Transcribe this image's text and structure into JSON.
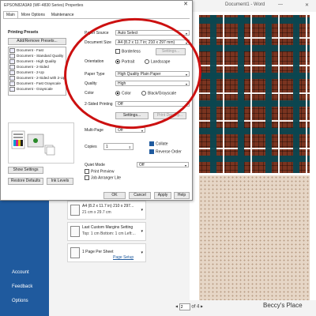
{
  "backstage": {
    "doc_title": "Document1 - Word",
    "menu": [
      "Account",
      "Feedback",
      "Options"
    ],
    "settings": [
      {
        "line1": "A4 (8.2 x 11.7 in) 210 x 297...",
        "line2": "21 cm x 29.7 cm"
      },
      {
        "line1": "Last Custom Margins Setting",
        "line2": "Top: 1 cm Bottom: 1 cm Left:..."
      },
      {
        "line1": "1 Page Per Sheet",
        "line2": ""
      }
    ],
    "page_setup_link": "Page Setup",
    "pager": {
      "current": "2",
      "of_label": "of 4"
    },
    "watermark": "Beccy's Place"
  },
  "dialog": {
    "title": "EPSON82A3A9 (WF-4830 Series) Properties",
    "close_glyph": "✕",
    "tabs": [
      "Main",
      "More Options",
      "Maintenance"
    ],
    "printing_presets_label": "Printing Presets",
    "add_remove_presets": "Add/Remove Presets...",
    "presets": [
      "Document - Fast",
      "Document - Standard Quality",
      "Document - High Quality",
      "Document - 2-Sided",
      "Document - 2-Up",
      "Document - 2-Sided with 2-Up",
      "Document - Fast Grayscale",
      "Document - Grayscale"
    ],
    "show_settings": "Show Settings",
    "restore_defaults": "Restore Defaults",
    "ink_levels": "Ink Levels",
    "paper_source_label": "Paper Source",
    "paper_source_value": "Auto Select",
    "document_size_label": "Document Size",
    "document_size_value": "A4 (8.2 x 11.7 in; 210 x 297 mm)",
    "borderless_label": "Borderless",
    "settings_btn_disabled": "Settings...",
    "orientation_label": "Orientation",
    "portrait_label": "Portrait",
    "landscape_label": "Landscape",
    "paper_type_label": "Paper Type",
    "paper_type_value": "High Quality Plain Paper",
    "quality_label": "Quality",
    "quality_value": "High",
    "color_label": "Color",
    "color_option": "Color",
    "bw_option": "Black/Grayscale",
    "two_sided_label": "2-Sided Printing",
    "two_sided_value": "Off",
    "settings_btn": "Settings...",
    "print_density_btn": "Print Density...",
    "multi_page_label": "Multi-Page",
    "multi_page_value": "Off",
    "copies_label": "Copies",
    "copies_value": "1",
    "collate_label": "Collate",
    "reverse_order_label": "Reverse Order",
    "quiet_mode_label": "Quiet Mode",
    "quiet_mode_value": "Off",
    "print_preview_label": "Print Preview",
    "job_arranger_label": "Job Arranger Lite",
    "ok": "OK",
    "cancel": "Cancel",
    "apply": "Apply",
    "help": "Help"
  },
  "colors": {
    "word_blue": "#1f5a9e",
    "annotation_red": "#cc1010"
  }
}
